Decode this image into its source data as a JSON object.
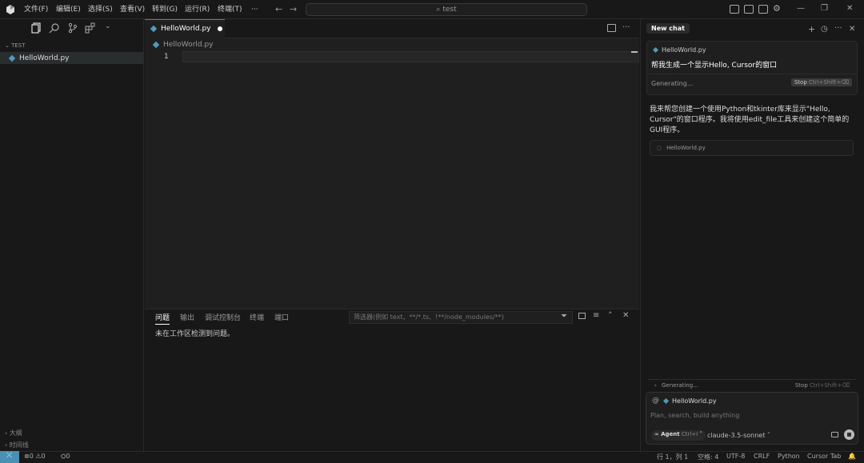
{
  "menu": [
    "文件(F)",
    "编辑(E)",
    "选择(S)",
    "查看(V)",
    "转到(G)",
    "运行(R)",
    "终端(T)",
    "···"
  ],
  "search": {
    "text": "test"
  },
  "sidebar": {
    "section": "TEST",
    "file": "HelloWorld.py",
    "outline": "大纲",
    "timeline": "时间线"
  },
  "editor": {
    "tab": "HelloWorld.py",
    "breadcrumb": "HelloWorld.py",
    "line_number": "1"
  },
  "panel": {
    "tabs": [
      "问题",
      "输出",
      "调试控制台",
      "终端",
      "端口"
    ],
    "filter_placeholder": "筛选器(例如 text、**/*.ts、!**/node_modules/**)",
    "message": "未在工作区检测到问题。"
  },
  "chat": {
    "title": "New chat",
    "context_file": "HelloWorld.py",
    "user_message": "帮我生成一个显示Hello, Cursor的窗口",
    "generating": "Generating...",
    "stop_label": "Stop",
    "stop_shortcut": "Ctrl+Shift+⌫",
    "reply": "我来帮您创建一个使用Python和tkinter库来显示\"Hello, Cursor\"的窗口程序。我将使用edit_file工具来创建这个简单的GUI程序。",
    "file_card": "HelloWorld.py",
    "bottom_generating": "Generating...",
    "bottom_stop": "Stop",
    "bottom_shortcut": "Ctrl+Shift+⌫",
    "input_file": "HelloWorld.py",
    "input_placeholder": "Plan, search, build anything",
    "mode": "Agent",
    "mode_shortcut": "Ctrl+I",
    "model": "claude-3.5-sonnet"
  },
  "status": {
    "errors": "0",
    "warnings": "0",
    "ports": "0",
    "position": "行 1，列 1",
    "spaces": "空格: 4",
    "encoding": "UTF-8",
    "eol": "CRLF",
    "language": "Python",
    "cursor_tab": "Cursor Tab"
  }
}
